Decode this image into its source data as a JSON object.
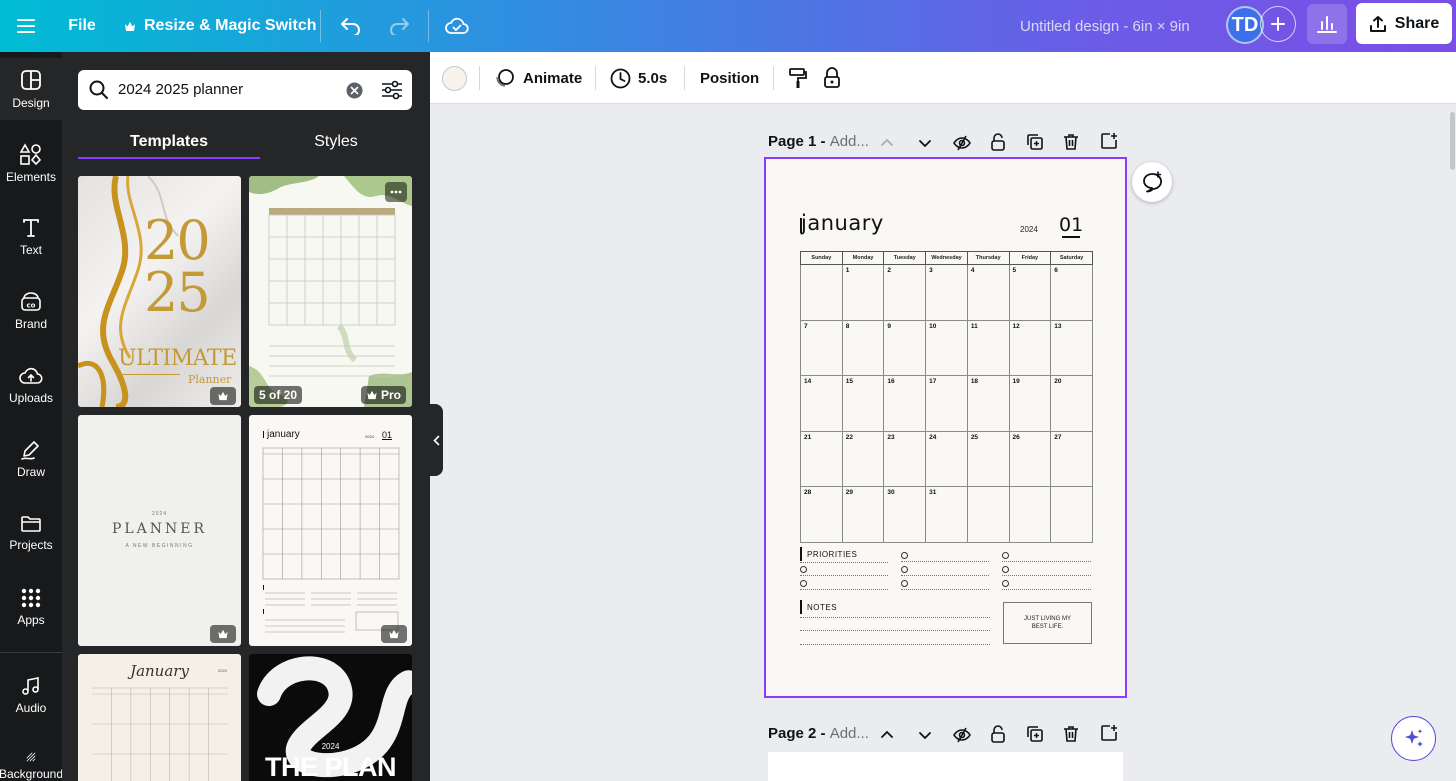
{
  "topbar": {
    "file_label": "File",
    "resize_label": "Resize & Magic Switch",
    "title": "Untitled design - 6in × 9in",
    "avatar_initials": "TD",
    "share_label": "Share"
  },
  "rail": {
    "items": [
      {
        "label": "Design",
        "icon": "design-icon",
        "active": true
      },
      {
        "label": "Elements",
        "icon": "elements-icon"
      },
      {
        "label": "Text",
        "icon": "text-icon"
      },
      {
        "label": "Brand",
        "icon": "brand-icon"
      },
      {
        "label": "Uploads",
        "icon": "uploads-icon"
      },
      {
        "label": "Draw",
        "icon": "draw-icon"
      },
      {
        "label": "Projects",
        "icon": "projects-icon"
      },
      {
        "label": "Apps",
        "icon": "apps-icon"
      },
      {
        "label": "Audio",
        "icon": "audio-icon"
      },
      {
        "label": "Background",
        "icon": "background-icon"
      }
    ]
  },
  "panel": {
    "search_value": "2024 2025 planner",
    "tabs": [
      {
        "label": "Templates",
        "active": true
      },
      {
        "label": "Styles"
      }
    ],
    "thumbs": {
      "t1": {
        "line1": "20",
        "line2": "25",
        "line3": "ULTIMATE",
        "line4": "Planner"
      },
      "t2": {
        "badge_count": "5 of 20",
        "badge_pro": "Pro"
      },
      "t3": {
        "year": "2024",
        "title": "PLANNER",
        "subtitle": "A NEW BEGINNING"
      },
      "t4": {
        "month": "january",
        "year": "2024",
        "num": "01"
      },
      "t5": {
        "month": "January",
        "year": "2024"
      },
      "t6": {
        "year": "2024",
        "title": "THE PLAN"
      }
    }
  },
  "toolbar": {
    "animate_label": "Animate",
    "duration_label": "5.0s",
    "position_label": "Position"
  },
  "pages": {
    "page1": {
      "label": "Page 1 -",
      "add": "Add..."
    },
    "page2": {
      "label": "Page 2 -",
      "add": "Add..."
    }
  },
  "calendar": {
    "month": "january",
    "year": "2024",
    "month_num": "01",
    "weekdays": [
      "Sunday",
      "Monday",
      "Tuesday",
      "Wednesday",
      "Thursday",
      "Friday",
      "Saturday"
    ],
    "weeks": [
      [
        "",
        "1",
        "2",
        "3",
        "4",
        "5",
        "6"
      ],
      [
        "7",
        "8",
        "9",
        "10",
        "11",
        "12",
        "13"
      ],
      [
        "14",
        "15",
        "16",
        "17",
        "18",
        "19",
        "20"
      ],
      [
        "21",
        "22",
        "23",
        "24",
        "25",
        "26",
        "27"
      ],
      [
        "28",
        "29",
        "30",
        "31",
        "",
        "",
        ""
      ]
    ],
    "priorities_label": "PRIORITIES",
    "notes_label": "NOTES",
    "quote": "JUST LIVING MY BEST LIFE."
  },
  "colors": {
    "accent": "#8b3dff",
    "rail_bg": "#18191b",
    "panel_bg": "#252627",
    "page_bg": "#faf8f4"
  }
}
